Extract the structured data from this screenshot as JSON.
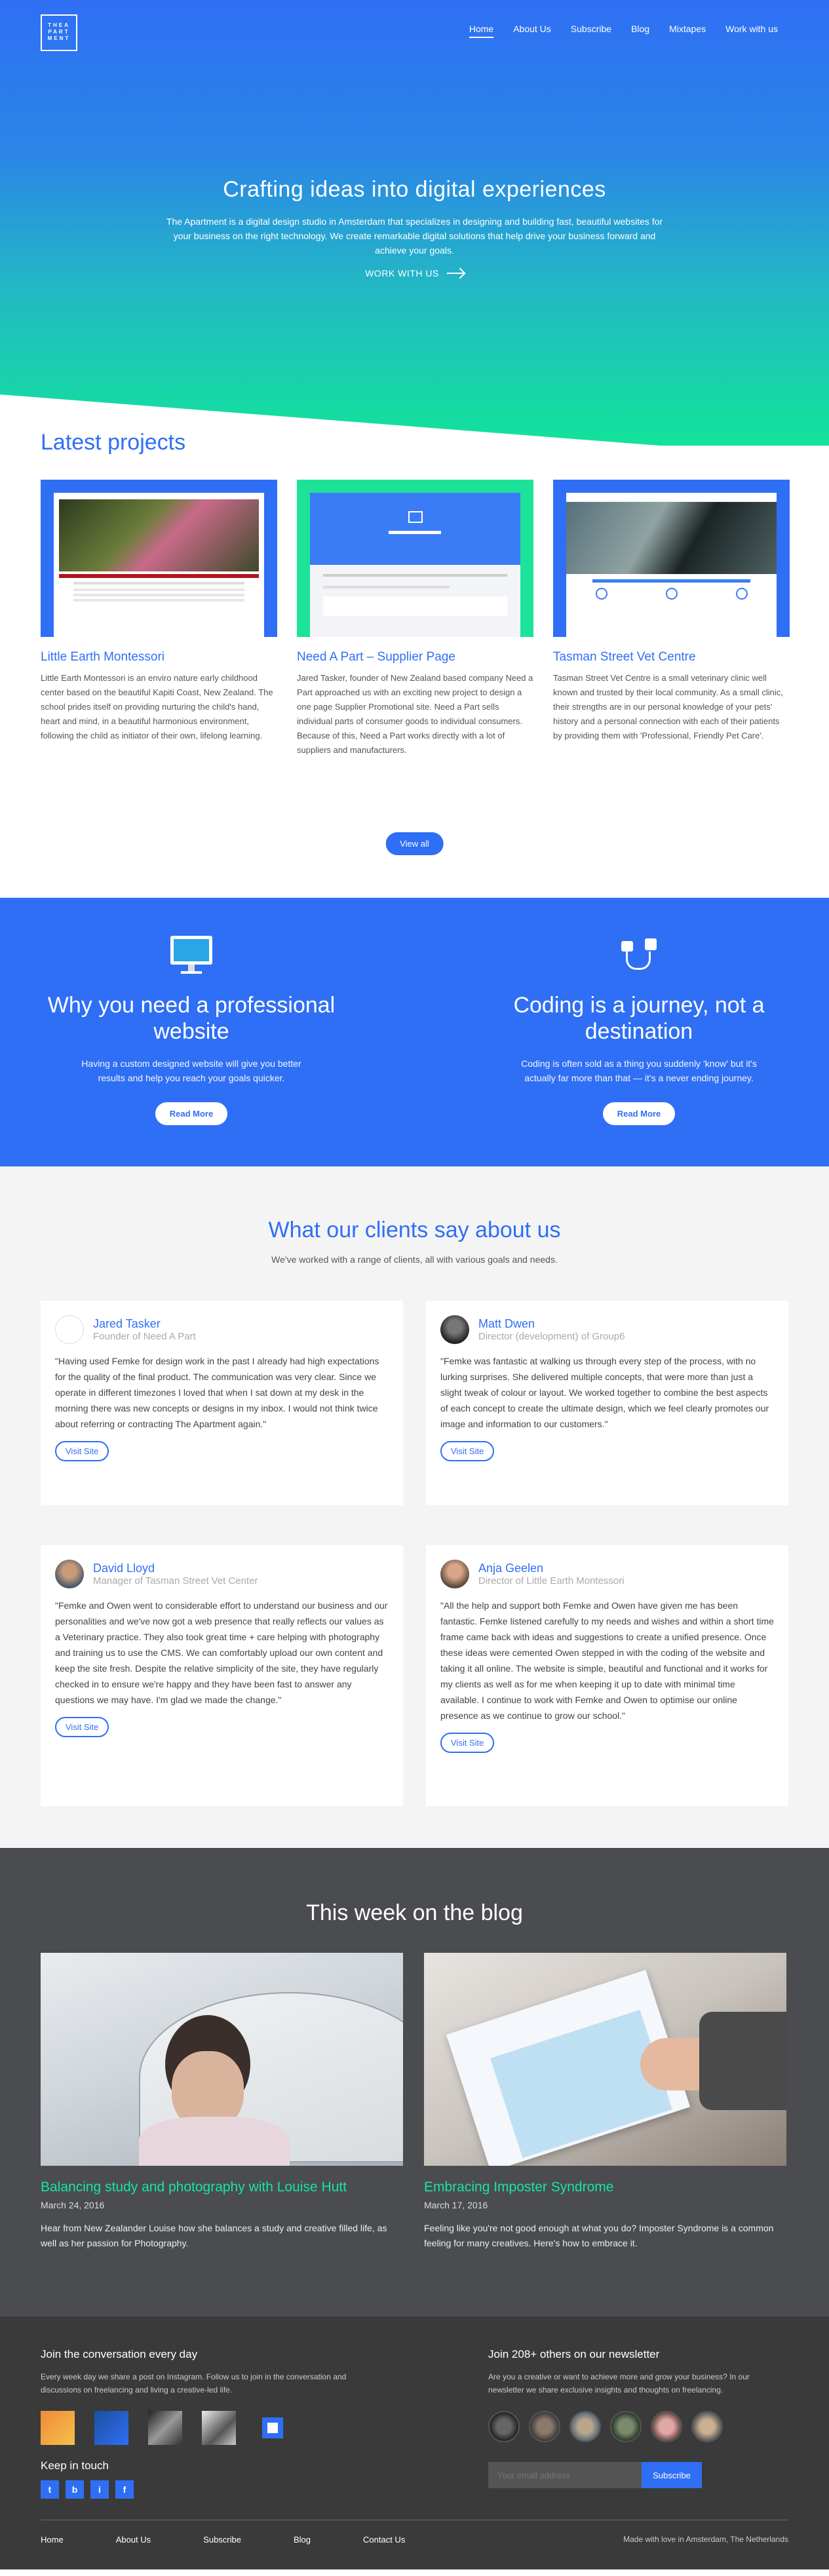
{
  "brand": {
    "logo_lines": [
      "THEA",
      "PART",
      "MENT"
    ]
  },
  "nav": [
    {
      "label": "Home",
      "active": true
    },
    {
      "label": "About Us"
    },
    {
      "label": "Subscribe"
    },
    {
      "label": "Blog"
    },
    {
      "label": "Mixtapes"
    },
    {
      "label": "Work with us"
    }
  ],
  "hero": {
    "title": "Crafting ideas into digital experiences",
    "text": "The Apartment is a digital design studio in Amsterdam that specializes in designing and building fast, beautiful websites for your business on the right technology. We create remarkable digital solutions that help drive your business forward and achieve your goals.",
    "cta": "WORK WITH US"
  },
  "projects": {
    "heading": "Latest projects",
    "items": [
      {
        "title": "Little Earth Montessori",
        "text": "Little Earth Montessori is an enviro nature early childhood center based on the beautiful Kapiti Coast, New Zealand. The school prides itself on providing nurturing the child's hand, heart and mind, in a beautiful harmonious environment, following the child as initiator of their own, lifelong learning.",
        "color": "#2f6ff5"
      },
      {
        "title": "Need A Part – Supplier Page",
        "text": "Jared Tasker, founder of New Zealand based company Need a Part approached us with an exciting new project to design a one page Supplier Promotional site. Need a Part sells individual parts of consumer goods to individual consumers. Because of this, Need a Part works directly with a lot of suppliers and manufacturers.",
        "color": "#1de39a"
      },
      {
        "title": "Tasman Street Vet Centre",
        "text": "Tasman Street Vet Centre is a small veterinary clinic well known and trusted by their local community. As a small clinic, their strengths are in our personal knowledge of your pets' history and a personal connection with each of their patients by providing them with 'Professional, Friendly Pet Care'.",
        "color": "#2f6ff5"
      }
    ],
    "view_all": "View all"
  },
  "why": [
    {
      "title": "Why you need a professional website",
      "text": "Having a custom designed website will give you better results and help you reach your goals quicker.",
      "button": "Read More",
      "icon": "monitor-icon"
    },
    {
      "title": "Coding is a journey, not a destination",
      "text": "Coding is often sold as a thing you suddenly 'know' but it's actually far more than that — it's a never ending journey.",
      "button": "Read More",
      "icon": "plug-icon"
    }
  ],
  "clients": {
    "heading": "What our clients say about us",
    "subtitle": "We've worked with a range of clients, all with various goals and needs.",
    "items": [
      {
        "name": "Jared Tasker",
        "role": "Founder of Need A Part",
        "quote": "\"Having used Femke for design work in the past I already had high expectations for the quality of the final product. The communication was very clear. Since we operate in different timezones I loved that when I sat down at my desk in the morning there was new concepts or designs in my inbox. I would not think twice about referring or contracting The Apartment again.\"",
        "button": "Visit Site"
      },
      {
        "name": "Matt Dwen",
        "role": "Director (development) of Group6",
        "quote": "\"Femke was fantastic at walking us through every step of the process, with no lurking surprises. She delivered multiple concepts, that were more than just a slight tweak of colour or layout. We worked together to combine the best aspects of each concept to create the ultimate design, which we feel clearly promotes our image and information to our customers.\"",
        "button": "Visit Site"
      },
      {
        "name": "David Lloyd",
        "role": "Manager of Tasman Street Vet Center",
        "quote": "\"Femke and Owen went to considerable effort to understand our business and our personalities and we've now got a web presence that really reflects our values as a Veterinary practice. They also took great time + care helping with photography and training us to use the CMS. We can comfortably upload our own content and keep the site fresh. Despite the relative simplicity of the site, they have regularly checked in to ensure we're happy and they have been fast to answer any questions we may have. I'm glad we made the change.\"",
        "button": "Visit Site"
      },
      {
        "name": "Anja Geelen",
        "role": "Director of Little Earth Montessori",
        "quote": "\"All the help and support both Femke and Owen have given me has been fantastic. Femke listened carefully to my needs and wishes and within a short time frame came back with ideas and suggestions to create a unified presence. Once these ideas were cemented Owen stepped in with the coding of the website and taking it all online. The website is simple, beautiful and functional and it works for my clients as well as for me when keeping it up to date with minimal time available. I continue to work with Femke and Owen to optimise our online presence as we continue to grow our school.\"",
        "button": "Visit Site"
      }
    ]
  },
  "blog": {
    "heading": "This week on the blog",
    "posts": [
      {
        "title": "Balancing study and photography with Louise Hutt",
        "date": "March 24, 2016",
        "text": "Hear from New Zealander Louise how she balances a study and creative filled life, as well as her passion for Photography."
      },
      {
        "title": "Embracing Imposter Syndrome",
        "date": "March 17, 2016",
        "text": "Feeling like you're not good enough at what you do? Imposter Syndrome is a common feeling for many creatives. Here's how to embrace it."
      }
    ]
  },
  "footer": {
    "join_title": "Join the conversation every day",
    "join_text": "Every week day we share a post on Instagram. Follow us to join in the conversation and discussions on freelancing and living a creative-led life.",
    "keep": "Keep in touch",
    "social": [
      "t",
      "b",
      "i",
      "f"
    ],
    "news_title": "Join 208+ others on our newsletter",
    "news_text": "Are you a creative or want to achieve more and grow your business? In our newsletter we share exclusive insights and thoughts on freelancing.",
    "email_placeholder": "Your email address",
    "subscribe": "Subscribe",
    "links": [
      "Home",
      "About Us",
      "Subscribe",
      "Blog",
      "Contact Us"
    ],
    "made": "Made with love in Amsterdam, The Netherlands"
  }
}
